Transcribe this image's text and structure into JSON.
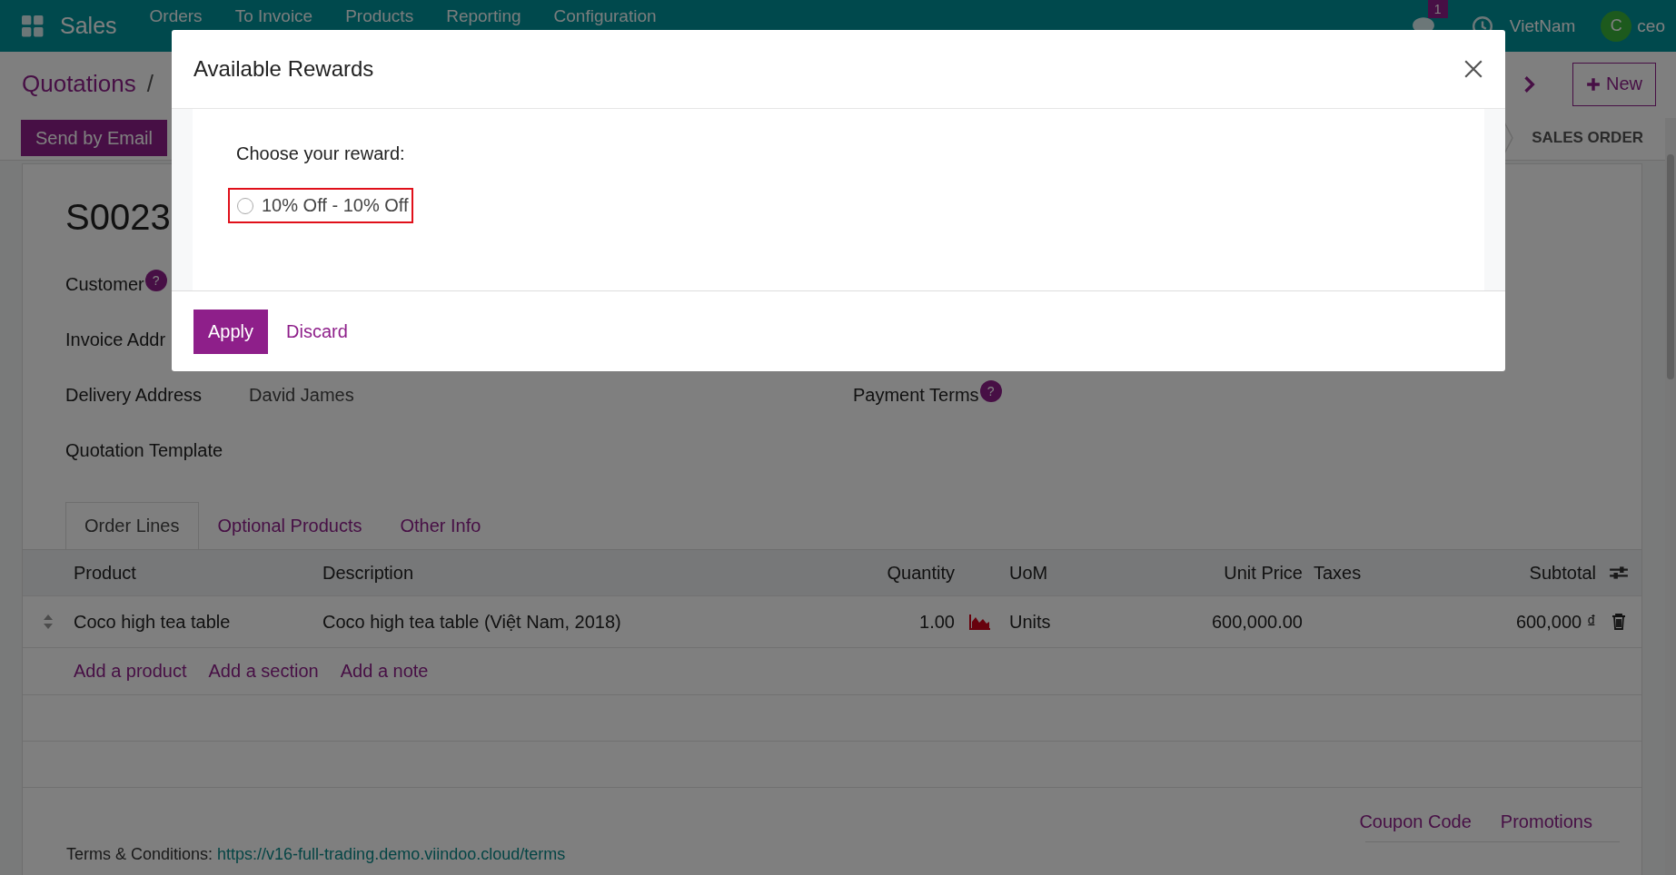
{
  "navbar": {
    "app": "Sales",
    "menu": [
      "Orders",
      "To Invoice",
      "Products",
      "Reporting",
      "Configuration"
    ],
    "messages_badge": "1",
    "company": "VietNam",
    "avatar_initial": "C",
    "user": "ceo"
  },
  "breadcrumb": {
    "parent": "Quotations",
    "separator": "/"
  },
  "actions": {
    "send_by_email": "Send by Email",
    "new": "New"
  },
  "status_stage": "SALES ORDER",
  "record": {
    "title": "S0023"
  },
  "fields_left": [
    {
      "label": "Customer",
      "help": "?"
    },
    {
      "label": "Invoice Addr"
    },
    {
      "label": "Delivery Address",
      "value": "David James"
    },
    {
      "label": "Quotation Template"
    }
  ],
  "fields_right": [
    {
      "label": "Payment Terms",
      "help": "?"
    }
  ],
  "tabs": [
    {
      "label": "Order Lines",
      "selected": true
    },
    {
      "label": "Optional Products",
      "selected": false
    },
    {
      "label": "Other Info",
      "selected": false
    }
  ],
  "table": {
    "columns": [
      "Product",
      "Description",
      "Quantity",
      "UoM",
      "Unit Price",
      "Taxes",
      "Subtotal"
    ],
    "rows": [
      {
        "product": "Coco high tea table",
        "description": "Coco high tea table (Việt Nam, 2018)",
        "quantity": "1.00",
        "uom": "Units",
        "unit_price": "600,000.00",
        "subtotal": "600,000 ₫"
      }
    ],
    "add_links": [
      "Add a product",
      "Add a section",
      "Add a note"
    ]
  },
  "footer": {
    "links": [
      "Coupon Code",
      "Promotions"
    ],
    "terms_label": "Terms & Conditions:",
    "terms_link": "https://v16-full-trading.demo.viindoo.cloud/terms"
  },
  "dialog": {
    "title": "Available Rewards",
    "prompt": "Choose your reward:",
    "options": [
      {
        "label": "10% Off - 10% Off",
        "selected": false,
        "highlighted": true
      }
    ],
    "buttons": [
      "Apply",
      "Discard"
    ]
  }
}
